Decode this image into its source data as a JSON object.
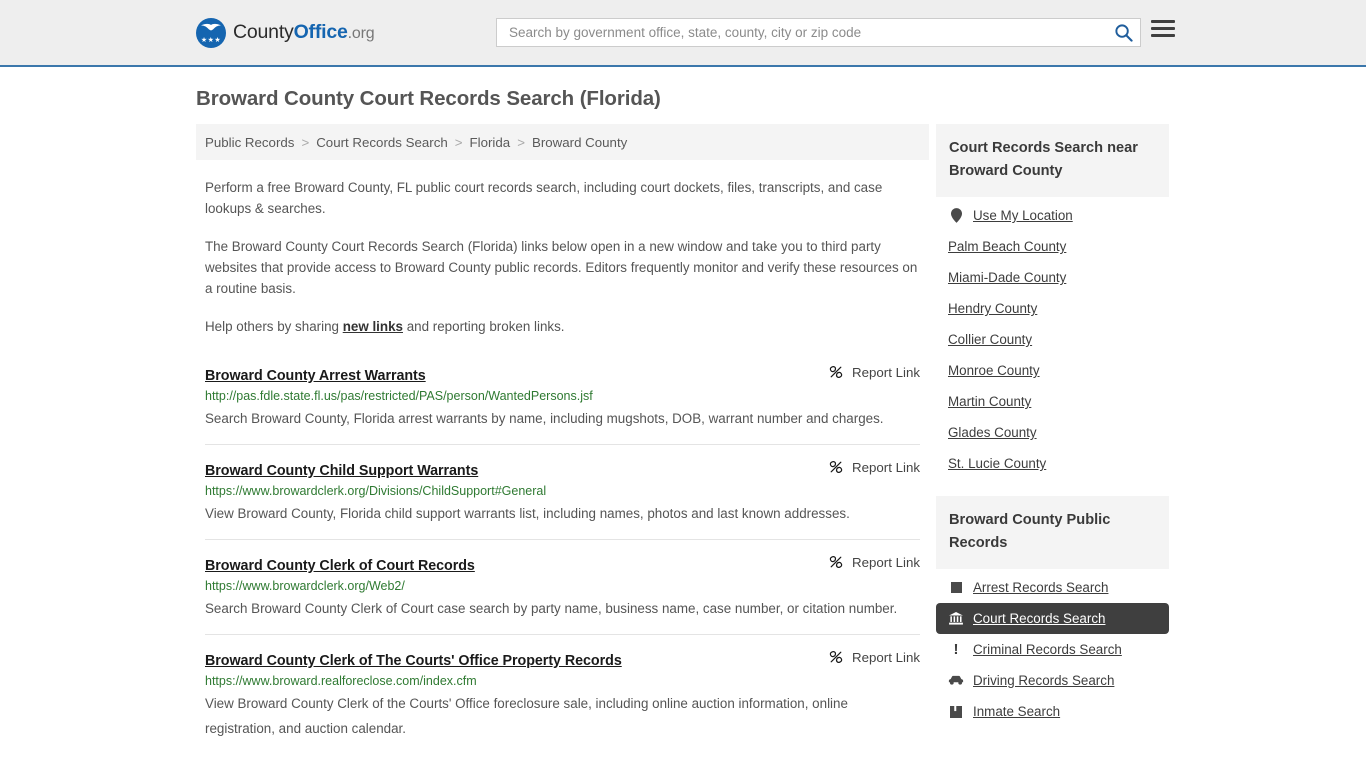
{
  "header": {
    "logo": {
      "part1": "County",
      "part2": "Office",
      "part3": ".org",
      "stars": "★★★"
    },
    "search": {
      "placeholder": "Search by government office, state, county, city or zip code",
      "value": "",
      "icon": "search-icon"
    },
    "menu_icon": "hamburger-menu-icon",
    "accent_color": "#3b77ab"
  },
  "page": {
    "title": "Broward County Court Records Search (Florida)"
  },
  "breadcrumb": {
    "separator": ">",
    "items": [
      {
        "label": "Public Records"
      },
      {
        "label": "Court Records Search"
      },
      {
        "label": "Florida"
      },
      {
        "label": "Broward County"
      }
    ]
  },
  "intro": {
    "paragraph1": "Perform a free Broward County, FL public court records search, including court dockets, files, transcripts, and case lookups & searches.",
    "paragraph2": "The Broward County Court Records Search (Florida) links below open in a new window and take you to third party websites that provide access to Broward County public records. Editors frequently monitor and verify these resources on a routine basis.",
    "paragraph3_before": "Help others by sharing ",
    "paragraph3_link": "new links",
    "paragraph3_after": " and reporting broken links."
  },
  "report_link_label": "Report Link",
  "report_link_icon": "broken-link-icon",
  "results": [
    {
      "title": "Broward County Arrest Warrants",
      "url": "http://pas.fdle.state.fl.us/pas/restricted/PAS/person/WantedPersons.jsf",
      "description": "Search Broward County, Florida arrest warrants by name, including mugshots, DOB, warrant number and charges."
    },
    {
      "title": "Broward County Child Support Warrants",
      "url": "https://www.browardclerk.org/Divisions/ChildSupport#General",
      "description": "View Broward County, Florida child support warrants list, including names, photos and last known addresses."
    },
    {
      "title": "Broward County Clerk of Court Records",
      "url": "https://www.browardclerk.org/Web2/",
      "description": "Search Broward County Clerk of Court case search by party name, business name, case number, or citation number."
    },
    {
      "title": "Broward County Clerk of The Courts' Office Property Records",
      "url": "https://www.broward.realforeclose.com/index.cfm",
      "description": "View Broward County Clerk of the Courts' Office foreclosure sale, including online auction information, online registration, and auction calendar."
    }
  ],
  "sidebar": {
    "nearby": {
      "heading": "Court Records Search near Broward County",
      "items": [
        {
          "label": "Use My Location",
          "icon": "map-pin-icon"
        },
        {
          "label": "Palm Beach County",
          "icon": ""
        },
        {
          "label": "Miami-Dade County",
          "icon": ""
        },
        {
          "label": "Hendry County",
          "icon": ""
        },
        {
          "label": "Collier County",
          "icon": ""
        },
        {
          "label": "Monroe County",
          "icon": ""
        },
        {
          "label": "Martin County",
          "icon": ""
        },
        {
          "label": "Glades County",
          "icon": ""
        },
        {
          "label": "St. Lucie County",
          "icon": ""
        }
      ]
    },
    "public_records": {
      "heading": "Broward County Public Records",
      "active_color": "#3f3f3f",
      "items": [
        {
          "label": "Arrest Records Search",
          "icon": "fingerprint-icon",
          "active": false
        },
        {
          "label": "Court Records Search",
          "icon": "courthouse-icon",
          "active": true
        },
        {
          "label": "Criminal Records Search",
          "icon": "exclamation-icon",
          "active": false
        },
        {
          "label": "Driving Records Search",
          "icon": "car-icon",
          "active": false
        },
        {
          "label": "Inmate Search",
          "icon": "jail-icon",
          "active": false
        }
      ]
    }
  }
}
